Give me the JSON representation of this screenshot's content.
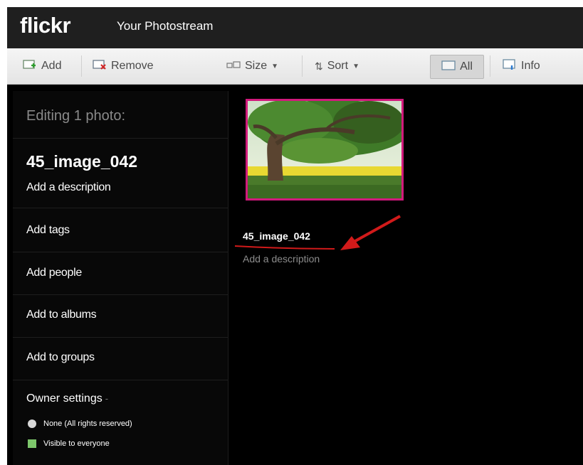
{
  "header": {
    "logo": "flickr",
    "page_title": "Your Photostream"
  },
  "toolbar": {
    "add_label": "Add",
    "remove_label": "Remove",
    "size_label": "Size",
    "sort_label": "Sort",
    "all_label": "All",
    "info_label": "Info"
  },
  "sidebar": {
    "editing_label": "Editing 1 photo:",
    "photo_title": "45_image_042",
    "add_description": "Add a description",
    "add_tags": "Add tags",
    "add_people": "Add people",
    "add_to_albums": "Add to albums",
    "add_to_groups": "Add to groups",
    "owner_settings": "Owner settings",
    "license": "None (All rights reserved)",
    "visibility": "Visible to everyone"
  },
  "photo": {
    "title": "45_image_042",
    "description_placeholder": "Add a description"
  },
  "colors": {
    "selection_border": "#d21a7c",
    "annotation_red": "#d11a1a",
    "visibility_green": "#7dc76b"
  }
}
